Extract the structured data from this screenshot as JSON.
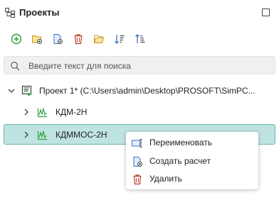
{
  "panel": {
    "title": "Проекты",
    "maximize_icon": "maximize-icon"
  },
  "toolbar": {
    "buttons": [
      {
        "name": "add-circle-icon",
        "color": "#2e9e3e"
      },
      {
        "name": "add-folder-icon",
        "color": "#d9a520"
      },
      {
        "name": "add-file-icon",
        "color": "#3b6fc7"
      },
      {
        "name": "delete-icon",
        "color": "#c0392b"
      },
      {
        "name": "open-folder-icon",
        "color": "#d9a520"
      },
      {
        "name": "sort-descending-icon",
        "color": "#3b6fc7"
      },
      {
        "name": "sort-ascending-icon",
        "color": "#3b6fc7"
      }
    ]
  },
  "search": {
    "placeholder": "Введите текст для поиска",
    "value": ""
  },
  "tree": {
    "root": {
      "label": "Проект 1* (C:\\Users\\admin\\Desktop\\PROSOFT\\SimPC...",
      "expanded": true
    },
    "items": [
      {
        "label": "КДМ-2Н",
        "selected": false
      },
      {
        "label": "КДММОС-2Н",
        "selected": true
      }
    ]
  },
  "context_menu": {
    "items": [
      {
        "label": "Переименовать",
        "icon": "rename-icon"
      },
      {
        "label": "Создать расчет",
        "icon": "create-calculation-icon"
      },
      {
        "label": "Удалить",
        "icon": "delete-icon"
      }
    ]
  },
  "colors": {
    "selection_bg": "#bfe3e0",
    "selection_border": "#6fb3ad",
    "accent_green": "#2e9e3e",
    "accent_blue": "#3b6fc7",
    "accent_red": "#c0392b",
    "accent_yellow": "#d9a520"
  }
}
